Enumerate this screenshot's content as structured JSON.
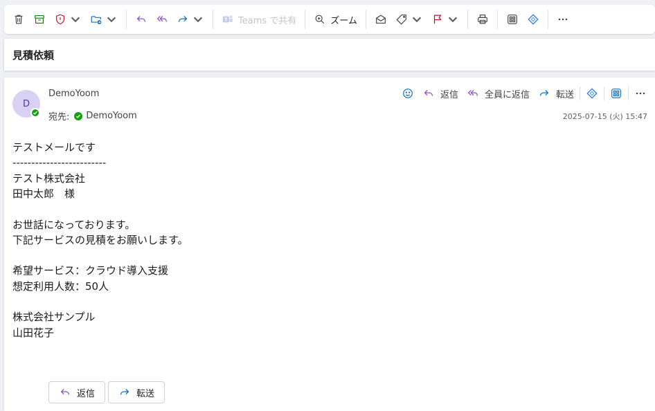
{
  "toolbar": {
    "teams_share_label": "Teams で共有",
    "zoom_label": "ズーム"
  },
  "subject": "見積依頼",
  "message": {
    "avatar_initial": "D",
    "sender": "DemoYoom",
    "to_label": "宛先:",
    "recipient": "DemoYoom",
    "date": "2025-07-15 (火) 15:47",
    "actions": {
      "reply": "返信",
      "reply_all": "全員に返信",
      "forward": "転送"
    },
    "body_lines": [
      "テストメールです",
      "-------------------------",
      "テスト株式会社",
      "田中太郎　様",
      "",
      "お世話になっております。",
      "下記サービスの見積をお願いします。",
      "",
      "希望サービス：クラウド導入支援",
      "想定利用人数：50人",
      "",
      "株式会社サンプル",
      "山田花子"
    ]
  },
  "bottom_actions": {
    "reply": "返信",
    "forward": "転送"
  },
  "colors": {
    "reply_purple": "#8e4ec6",
    "forward_blue": "#0f6cbd",
    "flag_red": "#c50f1f",
    "presence_green": "#13a10e"
  }
}
